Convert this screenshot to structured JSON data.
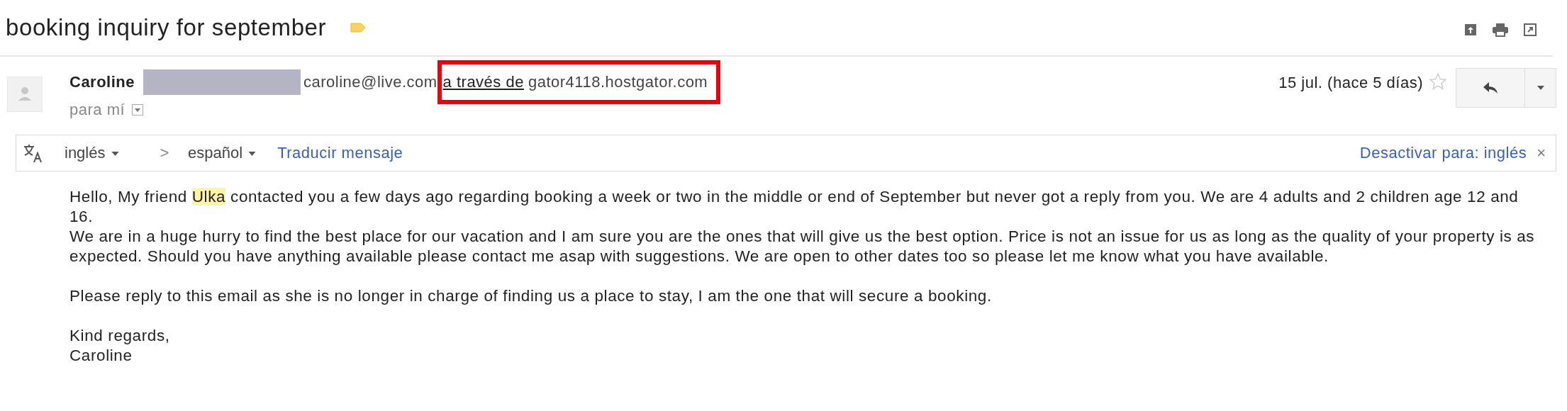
{
  "subject": "booking inquiry for september",
  "message": {
    "sender_name": "Caroline",
    "sender_email": "caroline@live.com",
    "via_label": "a través de",
    "via_host": "gator4118.hostgator.com",
    "recipient": "para mí",
    "date": "15 jul. (hace 5 días)",
    "starred": false
  },
  "translate": {
    "source": "inglés",
    "separator": ">",
    "target": "español",
    "action": "Traducir mensaje",
    "disable": "Desactivar para: inglés",
    "close": "×"
  },
  "body": [
    [
      [
        {
          "text": "Hello, My friend ",
          "highlighted": false
        },
        {
          "text": "Ulka",
          "highlighted": true
        },
        {
          "text": " contacted you a few days ago regarding booking a week or two in the middle or end of September but never got a reply from you. We are 4 adults and 2 children age 12 and 16.",
          "highlighted": false
        }
      ],
      [
        {
          "text": "We are in a huge hurry to find the best place for our vacation and I am sure you are the ones that will give us the best option. Price is not an issue for us as long as the quality of your property is as expected. Should you have anything available please contact me asap with suggestions. We are open to other dates too so please let me know what you have available.",
          "highlighted": false
        }
      ]
    ],
    [
      [
        {
          "text": "Please reply to this email as she is no longer in charge of finding us a place to stay, I am the one that will secure a booking.",
          "highlighted": false
        }
      ]
    ],
    [
      [
        {
          "text": "Kind regards,",
          "highlighted": false
        }
      ],
      [
        {
          "text": "Caroline",
          "highlighted": false
        }
      ]
    ]
  ]
}
